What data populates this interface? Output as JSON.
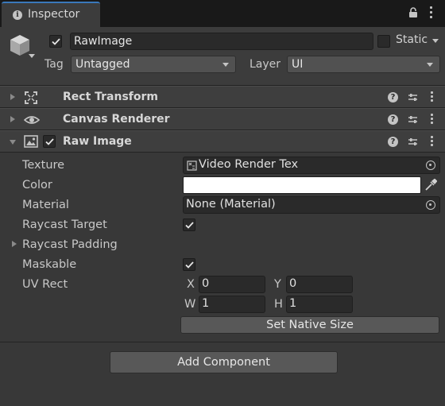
{
  "tab": {
    "icon": "info-icon",
    "label": "Inspector"
  },
  "header": {
    "name": "RawImage",
    "active": true,
    "static_label": "Static",
    "tag_label": "Tag",
    "tag_value": "Untagged",
    "layer_label": "Layer",
    "layer_value": "UI"
  },
  "components": [
    {
      "title": "Rect Transform",
      "icon": "rect-transform-icon",
      "expanded": false
    },
    {
      "title": "Canvas Renderer",
      "icon": "eye-icon",
      "expanded": false
    },
    {
      "title": "Raw Image",
      "icon": "image-icon",
      "expanded": true,
      "enabled": true
    }
  ],
  "raw_image": {
    "texture_label": "Texture",
    "texture_value": "Video Render Tex",
    "color_label": "Color",
    "color_value": "#FFFFFF",
    "material_label": "Material",
    "material_value": "None (Material)",
    "raycast_target_label": "Raycast Target",
    "raycast_target": true,
    "raycast_padding_label": "Raycast Padding",
    "maskable_label": "Maskable",
    "maskable": true,
    "uv_rect_label": "UV Rect",
    "uv": {
      "x_label": "X",
      "x": "0",
      "y_label": "Y",
      "y": "0",
      "w_label": "W",
      "w": "1",
      "h_label": "H",
      "h": "1"
    },
    "set_native_size": "Set Native Size"
  },
  "add_component": "Add Component"
}
